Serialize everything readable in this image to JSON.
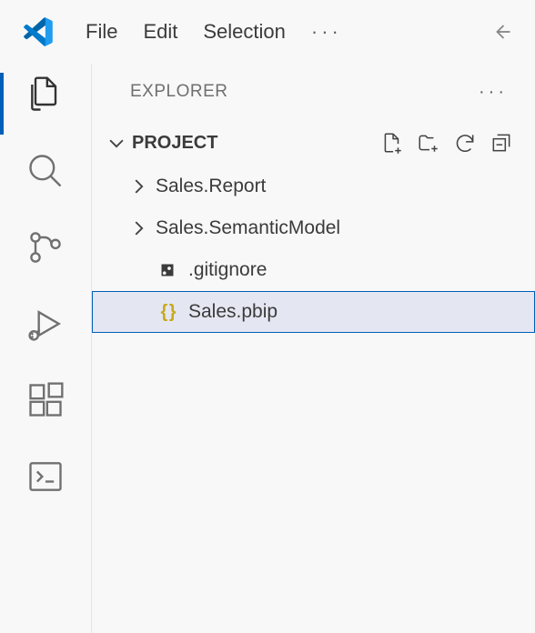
{
  "menu": {
    "file": "File",
    "edit": "Edit",
    "selection": "Selection",
    "more": "···"
  },
  "explorer": {
    "title": "EXPLORER",
    "more": "···",
    "section_title": "PROJECT"
  },
  "tree": {
    "items": [
      {
        "label": "Sales.Report"
      },
      {
        "label": "Sales.SemanticModel"
      },
      {
        "label": ".gitignore"
      },
      {
        "label": "Sales.pbip"
      }
    ]
  }
}
